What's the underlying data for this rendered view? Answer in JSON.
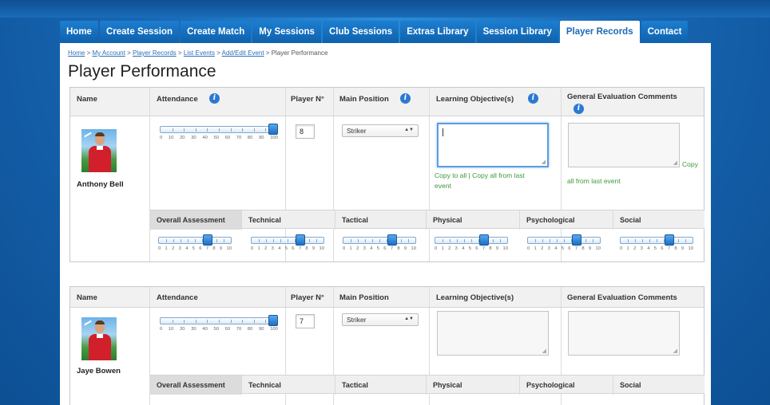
{
  "nav": {
    "tabs": [
      {
        "label": "Home"
      },
      {
        "label": "Create Session"
      },
      {
        "label": "Create Match"
      },
      {
        "label": "My Sessions"
      },
      {
        "label": "Club Sessions"
      },
      {
        "label": "Extras Library"
      },
      {
        "label": "Session Library"
      },
      {
        "label": "Player Records"
      },
      {
        "label": "Contact"
      }
    ],
    "active": "Player Records"
  },
  "breadcrumb": {
    "items": [
      "Home",
      "My Account",
      "Player Records",
      "List Events",
      "Add/Edit Event"
    ],
    "separator": ">",
    "current": "Player Performance"
  },
  "page_title": "Player Performance",
  "headers": {
    "name": "Name",
    "attendance": "Attendance",
    "player_no": "Player N°",
    "main_position": "Main Position",
    "learning_objectives": "Learning Objective(s)",
    "general_comments": "General Evaluation Comments"
  },
  "attendance_scale": [
    "0",
    "10",
    "20",
    "30",
    "40",
    "50",
    "60",
    "70",
    "80",
    "90",
    "100"
  ],
  "assessment_scale": [
    "0",
    "1",
    "2",
    "3",
    "4",
    "5",
    "6",
    "7",
    "8",
    "9",
    "10"
  ],
  "assessment_labels": [
    "Overall Assessment",
    "Technical",
    "Tactical",
    "Physical",
    "Psychological",
    "Social"
  ],
  "links": {
    "copy_to_all": "Copy to all",
    "copy_all_from_last": "Copy all from last event",
    "copy_all_split_1": "Copy all from last",
    "copy_all_split_2": "event",
    "copy_comment_1": "Copy",
    "copy_comment_2": "all from last event"
  },
  "players": [
    {
      "name": "Anthony Bell",
      "attendance": 100,
      "player_number": "8",
      "main_position": "Striker",
      "learning_objective": "",
      "general_comment": "",
      "assessments": {
        "overall": 7,
        "technical": 7,
        "tactical": 7,
        "physical": 7,
        "psychological": 7,
        "social": 7
      }
    },
    {
      "name": "Jaye Bowen",
      "attendance": 100,
      "player_number": "7",
      "main_position": "Striker",
      "learning_objective": "",
      "general_comment": ""
    }
  ],
  "colors": {
    "nav_tab": "#1670c4",
    "accent_link": "#2c6fb8",
    "green_link": "#3a9a3a",
    "slider_handle": "#2a7ad2"
  }
}
